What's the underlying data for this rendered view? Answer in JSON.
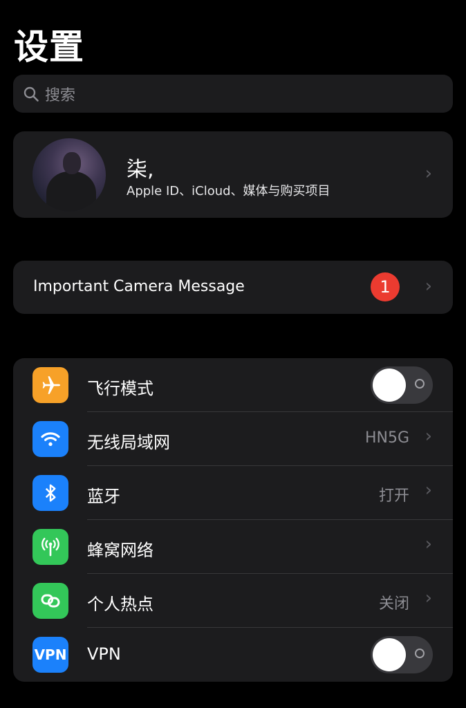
{
  "header": {
    "title": "设置"
  },
  "search": {
    "placeholder": "搜索"
  },
  "profile": {
    "name": "柒,",
    "subtitle": "Apple ID、iCloud、媒体与购买项目"
  },
  "camera_message": {
    "label": "Important Camera Message",
    "badge_count": "1"
  },
  "settings": {
    "airplane": {
      "label": "飞行模式",
      "toggle_on": false,
      "icon": "airplane-icon",
      "color": "#f7a128"
    },
    "wifi": {
      "label": "无线局域网",
      "value": "HN5G",
      "icon": "wifi-icon",
      "color": "#1b81fb"
    },
    "bluetooth": {
      "label": "蓝牙",
      "value": "打开",
      "icon": "bluetooth-icon",
      "color": "#1b81fb"
    },
    "cellular": {
      "label": "蜂窝网络",
      "icon": "cellular-antenna-icon",
      "color": "#33c759"
    },
    "hotspot": {
      "label": "个人热点",
      "value": "关闭",
      "icon": "hotspot-icon",
      "color": "#33c759"
    },
    "vpn": {
      "label": "VPN",
      "icon_text": "VPN",
      "toggle_on": false,
      "color": "#1b81fb"
    }
  }
}
